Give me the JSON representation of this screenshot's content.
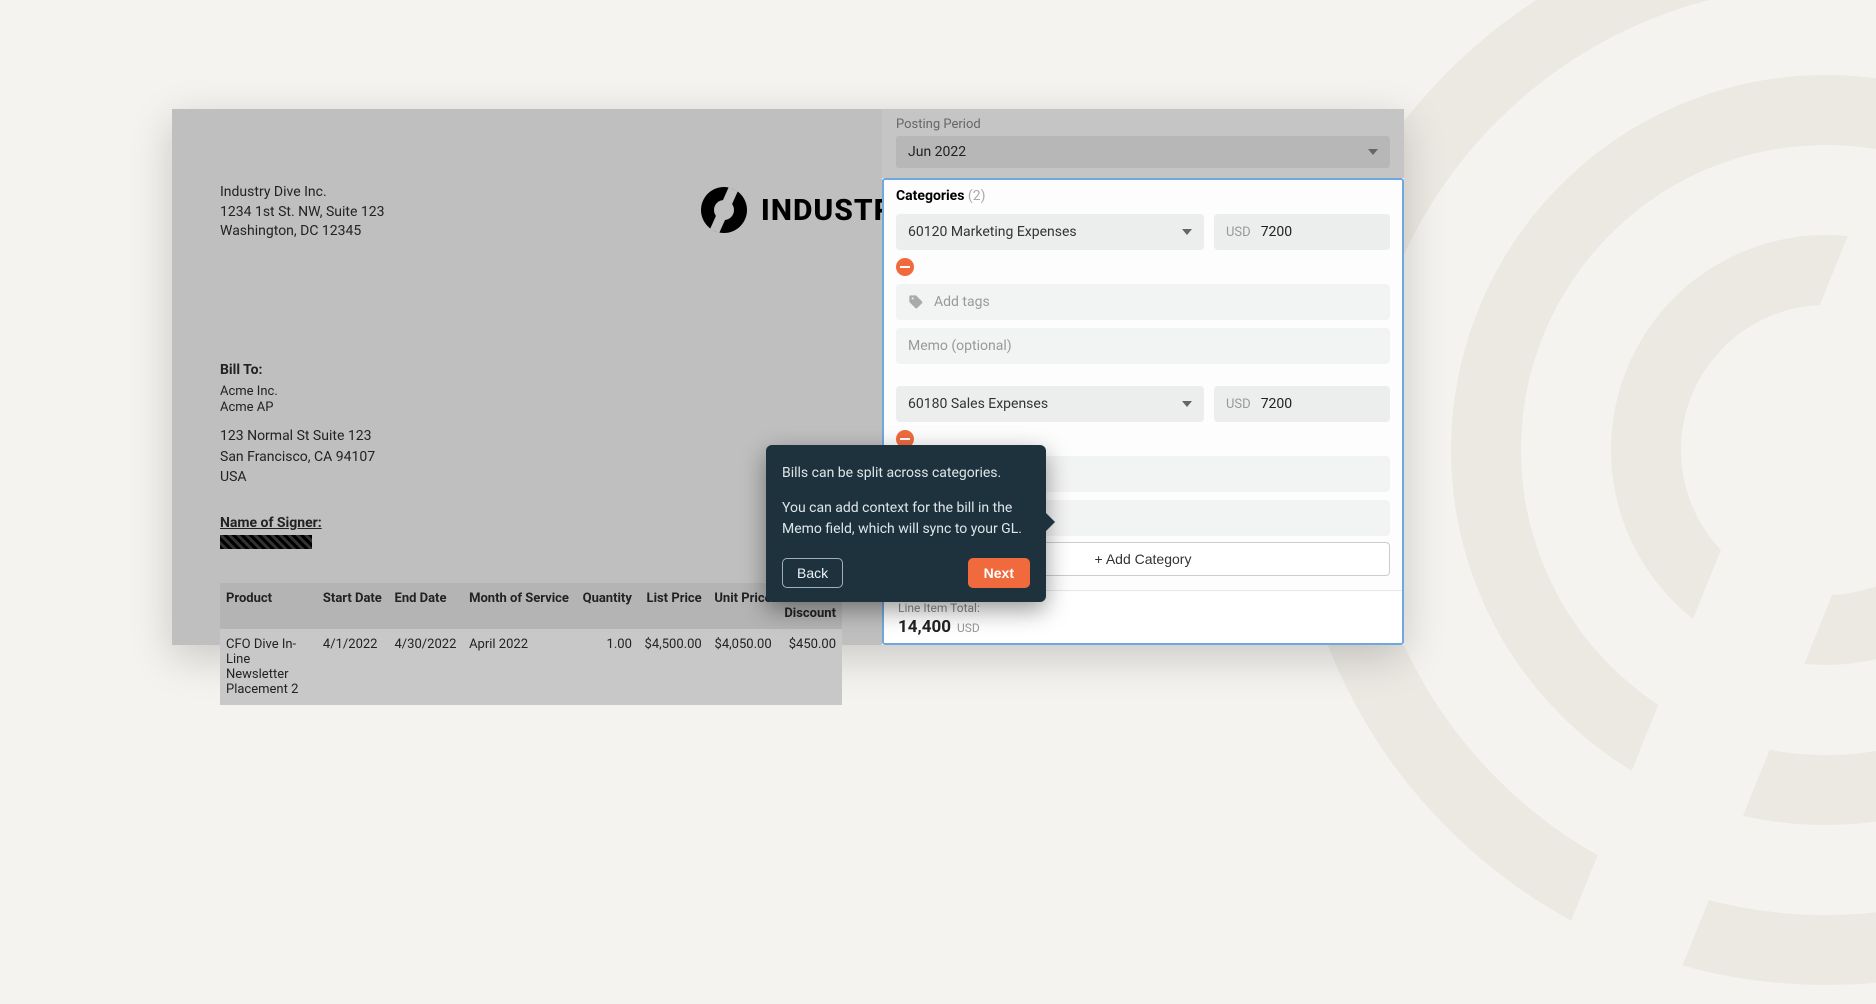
{
  "company": {
    "name": "Industry Dive Inc.",
    "street": "1234 1st St. NW, Suite 123",
    "citystate": "Washington, DC 12345",
    "logo_text": "INDUSTRY D"
  },
  "bill_to": {
    "label": "Bill To:",
    "name1": "Acme Inc.",
    "name2": "Acme AP",
    "street": "123 Normal St Suite 123",
    "citystate": "San Francisco, CA 94107",
    "country": "USA"
  },
  "signer": {
    "label": "Name of Signer:"
  },
  "table": {
    "headers": {
      "product": "Product",
      "start": "Start Date",
      "end": "End Date",
      "month": "Month of Service",
      "qty": "Quantity",
      "list": "List Price",
      "unit": "Unit Price",
      "discount": "Total\nDiscount"
    },
    "row": {
      "product": "CFO Dive In-Line Newsletter Placement 2",
      "start": "4/1/2022",
      "end": "4/30/2022",
      "month": "April 2022",
      "qty": "1.00",
      "list": "$4,500.00",
      "unit": "$4,050.00",
      "discount": "$450.00"
    }
  },
  "tour": {
    "p1": "Bills can be split across categories.",
    "p2": "You can add context for the bill in the Memo field, which will sync to your GL.",
    "back": "Back",
    "next": "Next"
  },
  "panel": {
    "posting_label": "Posting Period",
    "posting_value": "Jun 2022",
    "categories_label": "Categories",
    "categories_count": "(2)",
    "tags_placeholder": "Add tags",
    "memo_placeholder": "Memo (optional)",
    "add_category": "+ Add Category",
    "currency": "USD",
    "items": [
      {
        "name": "60120 Marketing Expenses",
        "amount": "7200"
      },
      {
        "name": "60180 Sales Expenses",
        "amount": "7200"
      }
    ],
    "totals": {
      "label": "Line Item Total:",
      "amount": "14,400",
      "currency": "USD"
    }
  }
}
